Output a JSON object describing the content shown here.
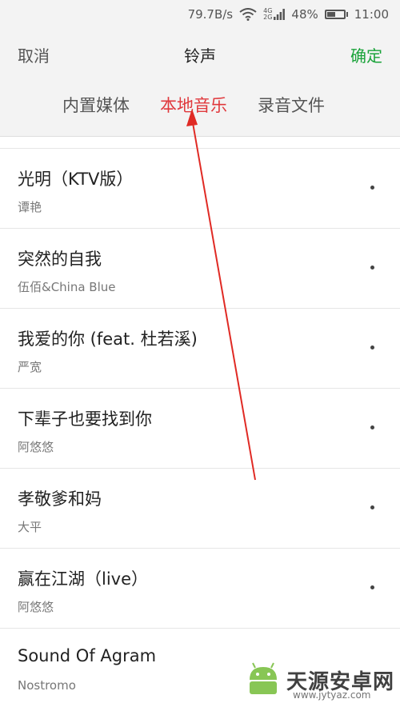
{
  "status_bar": {
    "speed": "79.7B/s",
    "network": "4G",
    "network_sub": "2G",
    "battery": "48%",
    "battery_level": 0.48,
    "time": "11:00",
    "icons": [
      "wifi-icon",
      "signal-icon",
      "battery-icon"
    ]
  },
  "header": {
    "cancel": "取消",
    "title": "铃声",
    "confirm": "确定",
    "confirm_color": "#1aa33a"
  },
  "tabs": [
    {
      "label": "内置媒体",
      "active": false
    },
    {
      "label": "本地音乐",
      "active": true
    },
    {
      "label": "录音文件",
      "active": false
    }
  ],
  "accent_color": "#e0383c",
  "songs": [
    {
      "title": "光明（KTV版）",
      "artist": "谭艳"
    },
    {
      "title": "突然的自我",
      "artist": "伍佰&China Blue"
    },
    {
      "title": "我爱的你 (feat. 杜若溪)",
      "artist": "严宽"
    },
    {
      "title": "下辈子也要找到你",
      "artist": "阿悠悠"
    },
    {
      "title": "孝敬爹和妈",
      "artist": "大平"
    },
    {
      "title": "赢在江湖（live）",
      "artist": "阿悠悠"
    },
    {
      "title": "Sound Of Agram",
      "artist": "Nostromo"
    }
  ],
  "watermark": {
    "name": "天源安卓网",
    "url": "www.jytyaz.com"
  }
}
